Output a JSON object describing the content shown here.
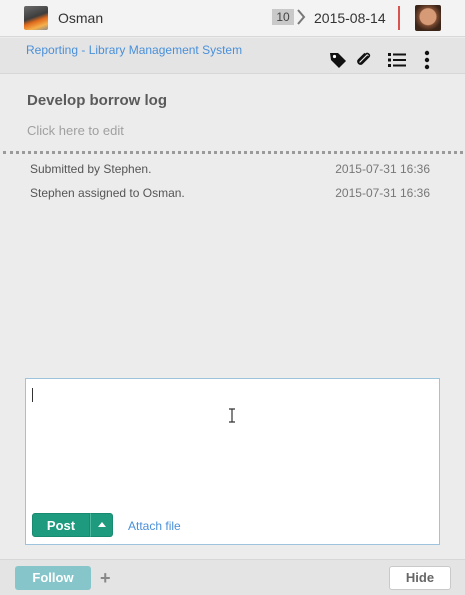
{
  "header": {
    "assignee": "Osman",
    "sprint": "10",
    "due_date": "2015-08-14",
    "accent_color": "#d9534f"
  },
  "subheader": {
    "breadcrumb": "Reporting - Library Management System",
    "icons": [
      "tag-icon",
      "paperclip-icon",
      "list-icon",
      "more-vertical-icon"
    ]
  },
  "task": {
    "title": "Develop borrow log",
    "edit_hint": "Click here to edit"
  },
  "activity": [
    {
      "text": "Submitted by Stephen.",
      "time": "2015-07-31 16:36"
    },
    {
      "text": "Stephen assigned to Osman.",
      "time": "2015-07-31 16:36"
    }
  ],
  "composer": {
    "post_label": "Post",
    "attach_label": "Attach file",
    "post_color": "#1e9b7e"
  },
  "footer": {
    "follow_label": "Follow",
    "plus_label": "+",
    "hide_label": "Hide"
  }
}
